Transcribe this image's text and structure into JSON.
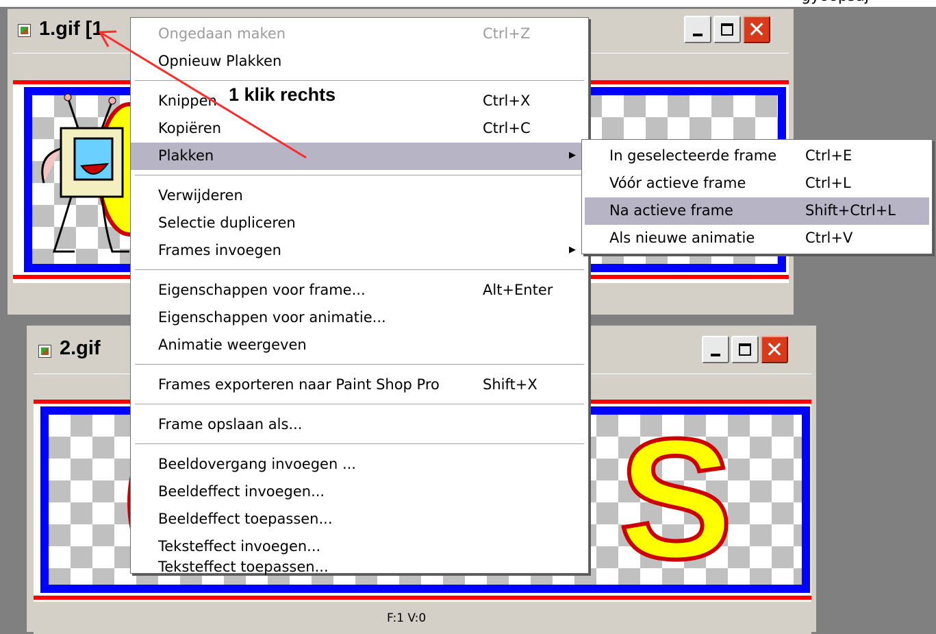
{
  "top_strip_text": "gyoopsaj",
  "window1": {
    "title": "1.gif [1"
  },
  "window2": {
    "title": "2.gif",
    "status": "F:1  V:0"
  },
  "context_menu": {
    "items": [
      {
        "label": "Ongedaan maken",
        "shortcut": "Ctrl+Z",
        "disabled": true
      },
      {
        "label": "Opnieuw Plakken",
        "shortcut": ""
      },
      {
        "label": "Knippen",
        "shortcut": "Ctrl+X"
      },
      {
        "label": "Kopiëren",
        "shortcut": "Ctrl+C"
      },
      {
        "label": "Plakken",
        "shortcut": "",
        "submenu": true,
        "highlighted": true
      },
      {
        "label": "Verwijderen",
        "shortcut": ""
      },
      {
        "label": "Selectie dupliceren",
        "shortcut": ""
      },
      {
        "label": "Frames invoegen",
        "shortcut": "",
        "submenu": true
      },
      {
        "label": "Eigenschappen voor frame...",
        "shortcut": "Alt+Enter"
      },
      {
        "label": "Eigenschappen voor animatie...",
        "shortcut": ""
      },
      {
        "label": "Animatie weergeven",
        "shortcut": ""
      },
      {
        "label": "Frames exporteren naar Paint Shop Pro",
        "shortcut": "Shift+X"
      },
      {
        "label": "Frame opslaan als...",
        "shortcut": ""
      },
      {
        "label": "Beeldovergang invoegen ...",
        "shortcut": ""
      },
      {
        "label": "Beeldeffect invoegen...",
        "shortcut": ""
      },
      {
        "label": "Beeldeffect toepassen...",
        "shortcut": ""
      },
      {
        "label": "Teksteffect invoegen...",
        "shortcut": ""
      },
      {
        "label": "Teksteffect toepassen...",
        "shortcut": ""
      }
    ]
  },
  "submenu": {
    "items": [
      {
        "label": "In geselecteerde frame",
        "shortcut": "Ctrl+E"
      },
      {
        "label": "Vóór actieve frame",
        "shortcut": "Ctrl+L"
      },
      {
        "label": "Na actieve frame",
        "shortcut": "Shift+Ctrl+L",
        "highlighted": true
      },
      {
        "label": "Als nieuwe animatie",
        "shortcut": "Ctrl+V"
      }
    ]
  },
  "annotation": "1 klik rechts",
  "colors": {
    "frame_border": "#0000ff",
    "frame_line": "#ff0000",
    "letter_fill": "#ffff00",
    "letter_outline": "#cc0000",
    "highlight": "#b6b4c5",
    "arrow": "#ff2a2a"
  },
  "icons": [
    "gif-file-icon",
    "minimize-icon",
    "maximize-icon",
    "close-icon",
    "submenu-arrow-icon"
  ]
}
